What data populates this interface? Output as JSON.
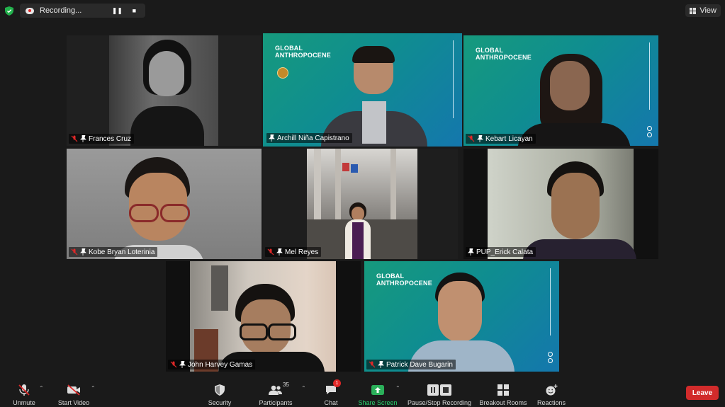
{
  "topbar": {
    "recording_label": "Recording...",
    "view_label": "View"
  },
  "participants": [
    {
      "name": "Frances Cruz",
      "muted": true,
      "video": "grayscale"
    },
    {
      "name": "Archill Niña Capistrano",
      "muted": false,
      "active_speaker": true,
      "video": "slide-background"
    },
    {
      "name": "Kebart Licayan",
      "muted": true,
      "video": "slide-background"
    },
    {
      "name": "Kobe Bryan Loterinia",
      "muted": true,
      "video": "camera"
    },
    {
      "name": "Mel Reyes",
      "muted": true,
      "video": "camera"
    },
    {
      "name": "PUP_Erick Calata",
      "muted": false,
      "video": "camera"
    },
    {
      "name": "John Harvey Gamas",
      "muted": true,
      "video": "camera"
    },
    {
      "name": "Patrick Dave Bugarin",
      "muted": true,
      "video": "slide-background"
    }
  ],
  "slide": {
    "title_line1": "GLOBAL",
    "title_line2": "ANTHROPOCENE"
  },
  "toolbar": {
    "unmute": "Unmute",
    "start_video": "Start Video",
    "security": "Security",
    "participants": "Participants",
    "participants_count": "35",
    "chat": "Chat",
    "chat_badge": "1",
    "share_screen": "Share Screen",
    "recording": "Pause/Stop Recording",
    "breakout_rooms": "Breakout Rooms",
    "reactions": "Reactions",
    "leave": "Leave"
  },
  "colors": {
    "active_speaker_border": "#f2e06a",
    "leave_button": "#d12b2b",
    "share_green": "#2bd46f",
    "mute_red": "#e02828"
  }
}
